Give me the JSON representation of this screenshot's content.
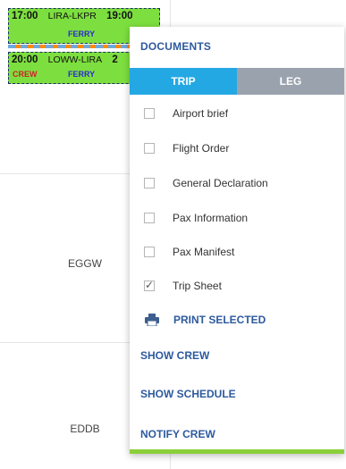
{
  "schedule": {
    "airports": [
      "EGGW",
      "EDDB"
    ],
    "flights": [
      {
        "departure_time": "17:00",
        "route": "LIRA-LKPR",
        "arrival_time": "19:00",
        "tag": "FERRY"
      },
      {
        "departure_time": "20:00",
        "route": "LOWW-LIRA",
        "arrival_time": "2",
        "crew_tag": "CREW",
        "tag": "FERRY"
      }
    ]
  },
  "menu": {
    "title": "DOCUMENTS",
    "tabs": [
      {
        "label": "TRIP",
        "active": true
      },
      {
        "label": "LEG",
        "active": false
      }
    ],
    "documents": [
      {
        "label": "Airport brief",
        "checked": false
      },
      {
        "label": "Flight Order",
        "checked": false
      },
      {
        "label": "General Declaration",
        "checked": false
      },
      {
        "label": "Pax Information",
        "checked": false
      },
      {
        "label": "Pax Manifest",
        "checked": false
      },
      {
        "label": "Trip Sheet",
        "checked": true
      }
    ],
    "print_label": "PRINT SELECTED",
    "actions": [
      "SHOW CREW",
      "SHOW SCHEDULE",
      "NOTIFY CREW"
    ],
    "colors": {
      "accent": "#2d5a9e",
      "tab_active": "#24a8e4",
      "tab_inactive": "#9aa2ad",
      "bottom_border": "#8bcf3a",
      "flight_block": "#7ddf3f"
    }
  }
}
